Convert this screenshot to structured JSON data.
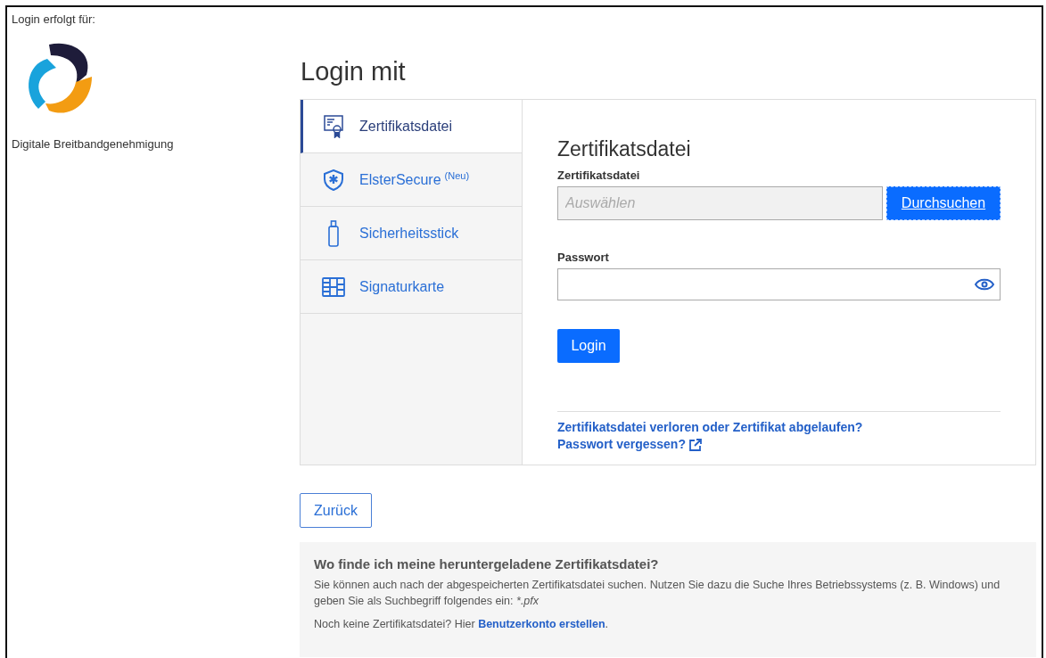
{
  "header": {
    "login_for": "Login erfolgt für:",
    "app_name": "Digitale Breitbandgenehmigung"
  },
  "title": "Login mit",
  "tabs": [
    {
      "label": "Zertifikatsdatei",
      "selected": true
    },
    {
      "label": "ElsterSecure",
      "superscript": "(Neu)",
      "selected": false
    },
    {
      "label": "Sicherheitsstick",
      "selected": false
    },
    {
      "label": "Signaturkarte",
      "selected": false
    }
  ],
  "form": {
    "heading": "Zertifikatsdatei",
    "file_label": "Zertifikatsdatei",
    "file_placeholder": "Auswählen",
    "browse_button": "Durchsuchen",
    "password_label": "Passwort",
    "login_button": "Login",
    "links": [
      {
        "text": "Zertifikatsdatei verloren oder Zertifikat abgelaufen?",
        "external": false
      },
      {
        "text": "Passwort vergessen?",
        "external": true
      }
    ]
  },
  "back_button": "Zurück",
  "help": {
    "heading": "Wo finde ich meine heruntergeladene Zertifikatsdatei?",
    "text": "Sie können auch nach der abgespeicherten Zertifikatsdatei suchen. Nutzen Sie dazu die Suche Ihres Betriebssystems (z. B. Windows) und geben Sie als Suchbegriff folgendes ein:",
    "pattern": "*.pfx",
    "note": "Noch keine Zertifikatsdatei? Hier",
    "note_link": "Benutzerkonto erstellen",
    "note_end": "."
  }
}
